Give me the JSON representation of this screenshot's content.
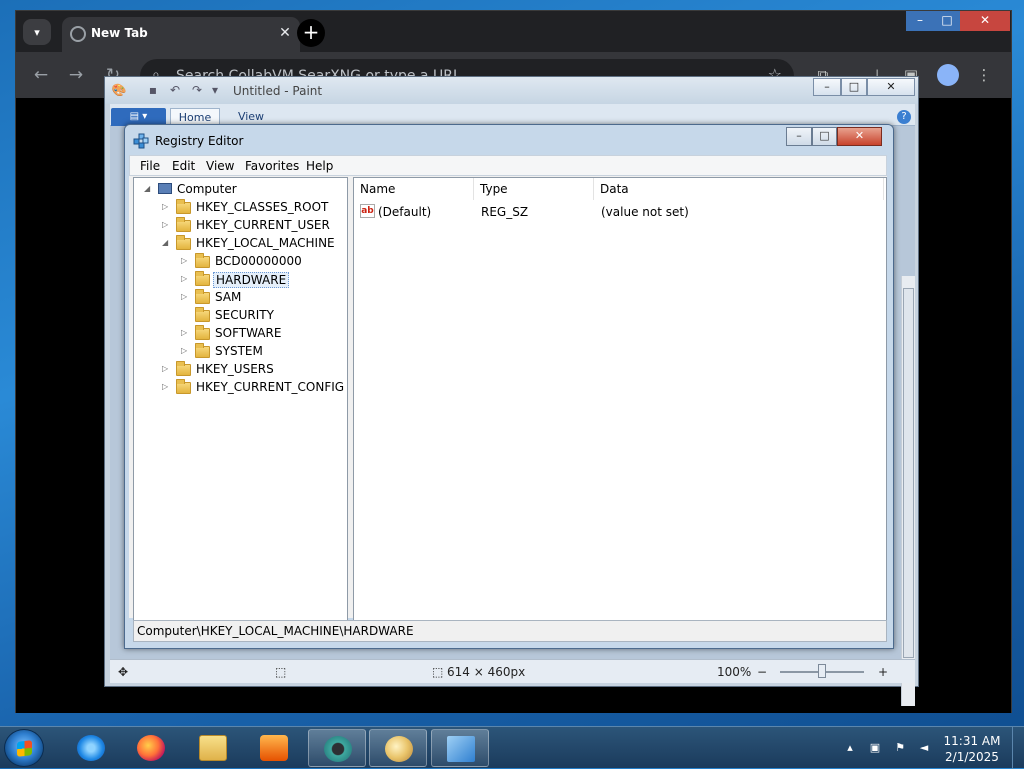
{
  "browser": {
    "tab_title": "New Tab",
    "tab_close": "✕",
    "new_tab": "+",
    "omnibox_placeholder": "Search CollabVM SearXNG or type a URL",
    "back_icon": "←",
    "forward_icon": "→",
    "reload_icon": "↻",
    "star_icon": "☆",
    "menu_icon": "⋮",
    "window": {
      "minimize": "–",
      "maximize": "□",
      "close": "✕"
    }
  },
  "paint": {
    "title": "Untitled - Paint",
    "tabs": [
      "Home",
      "View"
    ],
    "help": "?",
    "window": {
      "minimize": "–",
      "maximize": "□",
      "close": "✕"
    },
    "status": {
      "move_icon": "✥",
      "select_icon": "⬚",
      "size_icon": "⬚",
      "size": "614 × 460px",
      "zoom": "100%",
      "zoom_out": "−",
      "zoom_in": "+"
    }
  },
  "regedit": {
    "title": "Registry Editor",
    "window": {
      "minimize": "–",
      "maximize": "□",
      "close": "✕"
    },
    "menu": [
      "File",
      "Edit",
      "View",
      "Favorites",
      "Help"
    ],
    "tree": [
      {
        "label": "Computer",
        "level": 0,
        "expander": "◢"
      },
      {
        "label": "HKEY_CLASSES_ROOT",
        "level": 1,
        "expander": "▷"
      },
      {
        "label": "HKEY_CURRENT_USER",
        "level": 1,
        "expander": "▷"
      },
      {
        "label": "HKEY_LOCAL_MACHINE",
        "level": 1,
        "expander": "◢"
      },
      {
        "label": "BCD00000000",
        "level": 2,
        "expander": "▷"
      },
      {
        "label": "HARDWARE",
        "level": 2,
        "expander": "▷",
        "selected": true
      },
      {
        "label": "SAM",
        "level": 2,
        "expander": "▷"
      },
      {
        "label": "SECURITY",
        "level": 2,
        "expander": ""
      },
      {
        "label": "SOFTWARE",
        "level": 2,
        "expander": "▷"
      },
      {
        "label": "SYSTEM",
        "level": 2,
        "expander": "▷"
      },
      {
        "label": "HKEY_USERS",
        "level": 1,
        "expander": "▷"
      },
      {
        "label": "HKEY_CURRENT_CONFIG",
        "level": 1,
        "expander": "▷"
      }
    ],
    "columns": [
      "Name",
      "Type",
      "Data"
    ],
    "values": [
      {
        "icon": "ab",
        "name": "(Default)",
        "type": "REG_SZ",
        "data": "(value not set)"
      }
    ],
    "status_path": "Computer\\HKEY_LOCAL_MACHINE\\HARDWARE"
  },
  "taskbar": {
    "apps": [
      {
        "name": "internet-explorer",
        "open": false
      },
      {
        "name": "firefox",
        "open": false
      },
      {
        "name": "file-explorer",
        "open": false
      },
      {
        "name": "media-player",
        "open": false
      },
      {
        "name": "chrome",
        "open": true
      },
      {
        "name": "paint",
        "open": true
      },
      {
        "name": "registry-editor",
        "open": true
      }
    ],
    "time": "11:31 AM",
    "date": "2/1/2025"
  }
}
